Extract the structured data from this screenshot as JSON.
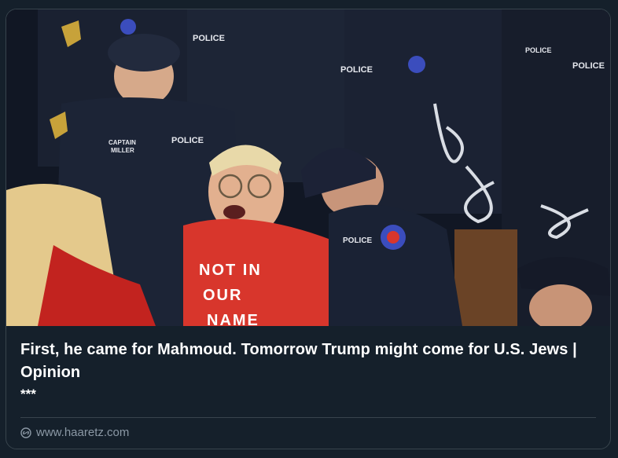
{
  "card": {
    "headline": "First, he came for Mahmoud. Tomorrow Trump might come for U.S. Jews | Opinion",
    "description": "***",
    "domain": "www.haaretz.com"
  },
  "photo": {
    "shirt_text": [
      "NOT IN",
      "OUR",
      "NAME"
    ],
    "badges": [
      "POLICE",
      "POLICE",
      "POLICE",
      "POLICE",
      "POLICE",
      "POLICE"
    ],
    "nameplate": [
      "CAPTAIN",
      "MILLER"
    ],
    "colors": {
      "uniform": "#1b2233",
      "shirt": "#d8362c",
      "background": "#0b0f17"
    }
  }
}
